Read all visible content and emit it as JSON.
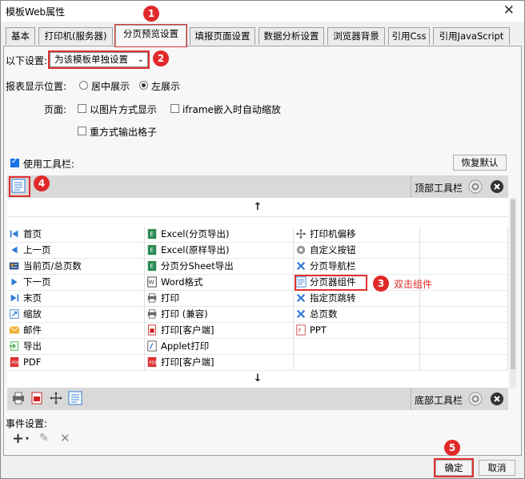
{
  "window": {
    "title": "模板Web属性",
    "close": "✕"
  },
  "tabs": [
    "基本",
    "打印机(服务器)",
    "分页预览设置",
    "填报页面设置",
    "数据分析设置",
    "浏览器背景",
    "引用Css",
    "引用JavaScript"
  ],
  "settings": {
    "label": "以下设置:",
    "select_value": "为该模板单独设置",
    "position_label": "报表显示位置:",
    "radio_center": "居中展示",
    "radio_left": "左展示",
    "page_label": "页面:",
    "cb_image": "以图片方式显示",
    "cb_iframe": "iframe嵌入时自动缩放",
    "cb_repeat": "重方式输出格子",
    "use_toolbar": "使用工具栏:",
    "restore_default": "恢复默认"
  },
  "toolbars": {
    "top_label": "顶部工具栏",
    "bottom_label": "底部工具栏",
    "up_arrow": "↑",
    "down_arrow": "↓"
  },
  "columns": [
    [
      "首页",
      "上一页",
      "当前页/总页数",
      "下一页",
      "末页",
      "缩放",
      "邮件",
      "导出",
      "PDF"
    ],
    [
      "Excel(分页导出)",
      "Excel(原样导出)",
      "分页分Sheet导出",
      "Word格式",
      "打印",
      "打印 (兼容)",
      "打印[客户端]",
      "Applet打印",
      "打印[客户端]"
    ],
    [
      "打印机偏移",
      "自定义按钮",
      "分页导航栏",
      "分页器组件",
      "指定页跳转",
      "总页数",
      "PPT"
    ]
  ],
  "events": {
    "label": "事件设置:"
  },
  "footer": {
    "ok": "确定",
    "cancel": "取消"
  },
  "annotations": {
    "b1": "1",
    "b2": "2",
    "b3": "3",
    "b4": "4",
    "b5": "5",
    "double_click": "双击组件"
  },
  "colors": {
    "accent_red": "#e02a2a",
    "icon_blue": "#2e7bd6",
    "toolbar_gray": "#d9d9d9"
  }
}
